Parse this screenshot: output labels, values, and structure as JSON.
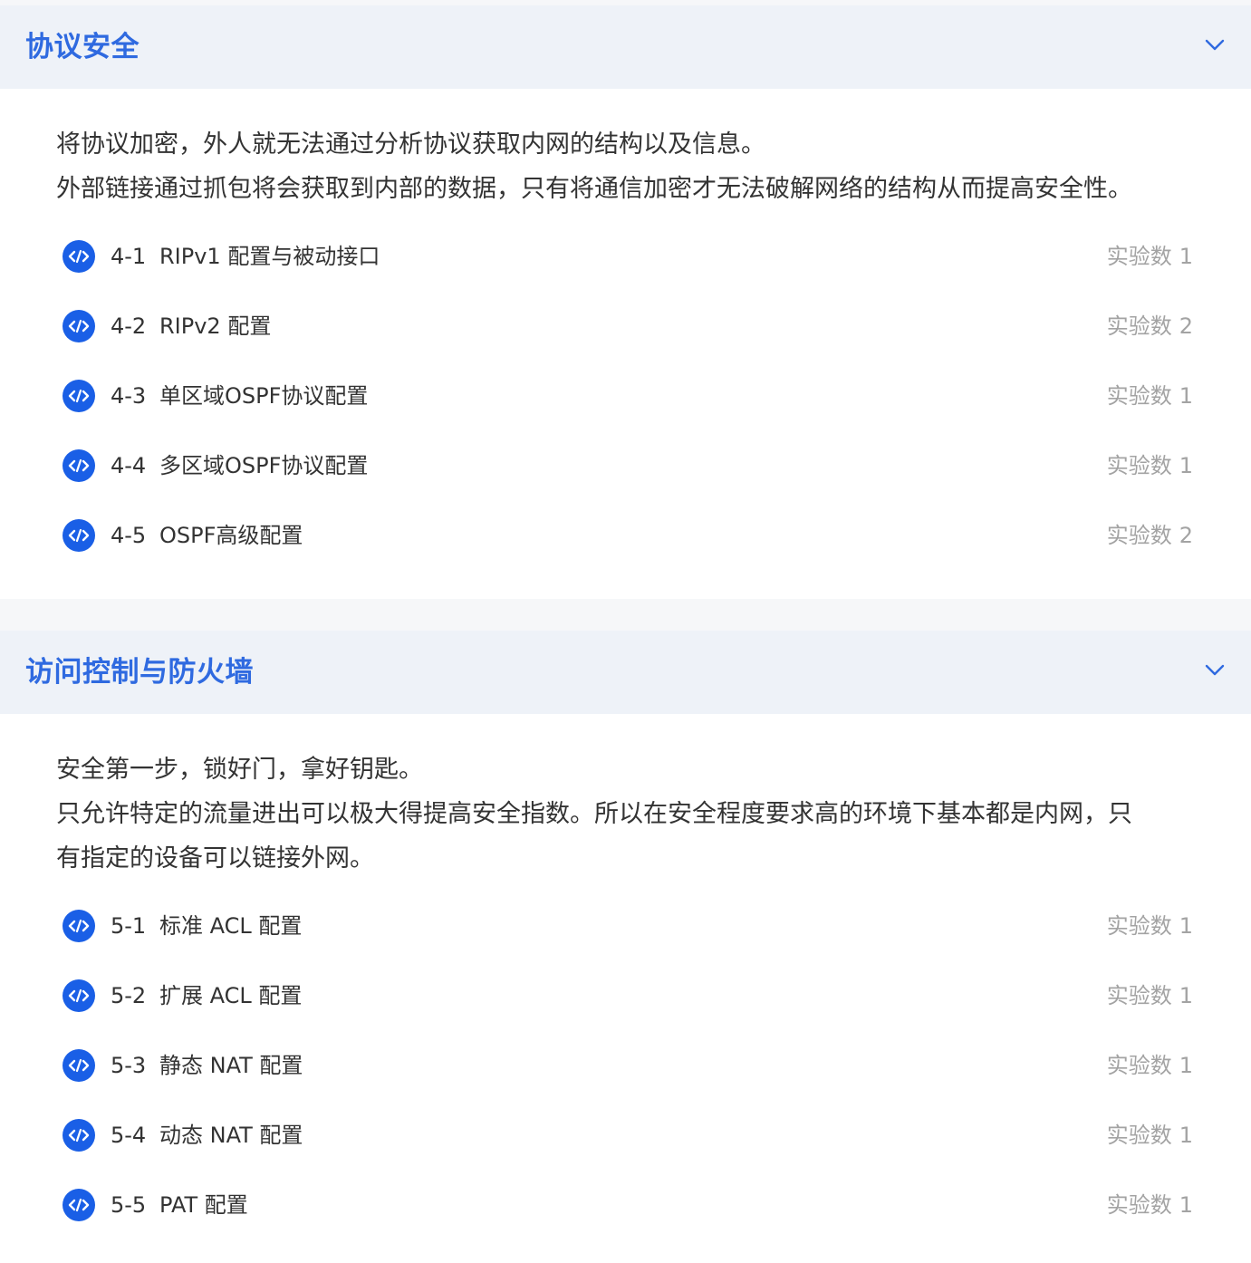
{
  "colors": {
    "accent": "#2f6ae0",
    "icon_blue": "#1a5fe6",
    "header_bg": "#eef2f8",
    "text": "#333333",
    "muted": "#a3a3a3"
  },
  "sections": [
    {
      "title": "协议安全",
      "toggle_icon": "chevron-down-icon",
      "description": [
        "将协议加密，外人就无法通过分析协议获取内网的结构以及信息。",
        "外部链接通过抓包将会获取到内部的数据，只有将通信加密才无法破解网络的结构从而提高安全性。"
      ],
      "lessons": [
        {
          "num": "4-1",
          "title": "RIPv1 配置与被动接口",
          "count_label": "实验数",
          "count": "1",
          "icon": "code-icon"
        },
        {
          "num": "4-2",
          "title": "RIPv2 配置",
          "count_label": "实验数",
          "count": "2",
          "icon": "code-icon"
        },
        {
          "num": "4-3",
          "title": "单区域OSPF协议配置",
          "count_label": "实验数",
          "count": "1",
          "icon": "code-icon"
        },
        {
          "num": "4-4",
          "title": "多区域OSPF协议配置",
          "count_label": "实验数",
          "count": "1",
          "icon": "code-icon"
        },
        {
          "num": "4-5",
          "title": "OSPF高级配置",
          "count_label": "实验数",
          "count": "2",
          "icon": "code-icon"
        }
      ]
    },
    {
      "title": "访问控制与防火墙",
      "toggle_icon": "chevron-down-icon",
      "description": [
        "安全第一步，锁好门，拿好钥匙。",
        "只允许特定的流量进出可以极大得提高安全指数。所以在安全程度要求高的环境下基本都是内网，只",
        "有指定的设备可以链接外网。"
      ],
      "lessons": [
        {
          "num": "5-1",
          "title": "标准 ACL 配置",
          "count_label": "实验数",
          "count": "1",
          "icon": "code-icon"
        },
        {
          "num": "5-2",
          "title": "扩展 ACL 配置",
          "count_label": "实验数",
          "count": "1",
          "icon": "code-icon"
        },
        {
          "num": "5-3",
          "title": "静态 NAT 配置",
          "count_label": "实验数",
          "count": "1",
          "icon": "code-icon"
        },
        {
          "num": "5-4",
          "title": "动态 NAT 配置",
          "count_label": "实验数",
          "count": "1",
          "icon": "code-icon"
        },
        {
          "num": "5-5",
          "title": "PAT 配置",
          "count_label": "实验数",
          "count": "1",
          "icon": "code-icon"
        }
      ]
    }
  ]
}
